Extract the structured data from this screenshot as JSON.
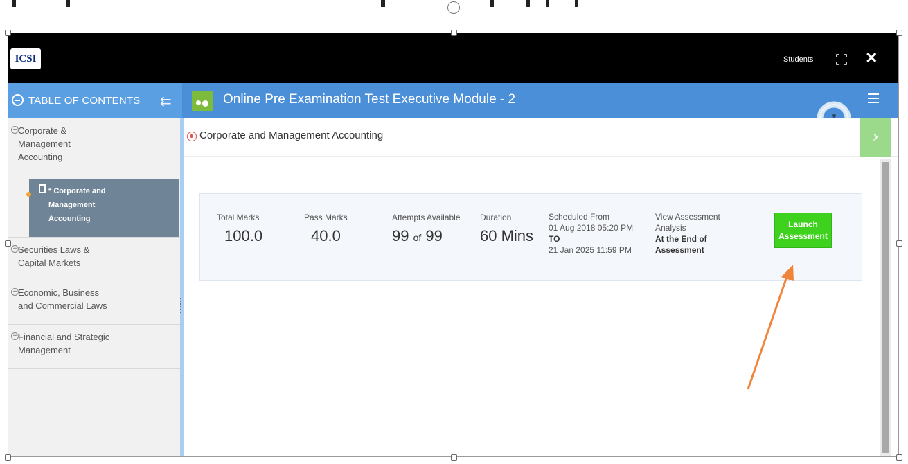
{
  "header": {
    "logo_text": "ICSI",
    "user_label": "Students"
  },
  "toc": {
    "title": "TABLE OF CONTENTS",
    "items": [
      {
        "label_lines": [
          "Corporate &",
          "Management",
          "Accounting"
        ],
        "expanded": true
      },
      {
        "label_lines": [
          "Securities Laws &",
          "Capital Markets"
        ],
        "expanded": false
      },
      {
        "label_lines": [
          "Economic, Business",
          "and Commercial Laws"
        ],
        "expanded": false
      },
      {
        "label_lines": [
          "Financial and Strategic",
          "Management"
        ],
        "expanded": false
      }
    ],
    "sub_item": {
      "label_lines": [
        "* Corporate and",
        "Management",
        "Accounting"
      ]
    }
  },
  "course": {
    "title": "Online Pre Examination Test Executive Module - 2"
  },
  "breadcrumb": {
    "title": "Corporate and Management Accounting"
  },
  "assessment": {
    "total_marks_label": "Total Marks",
    "total_marks": "100.0",
    "pass_marks_label": "Pass Marks",
    "pass_marks": "40.0",
    "attempts_label": "Attempts Available",
    "attempts_used": "99",
    "attempts_of": "of",
    "attempts_total": "99",
    "duration_label": "Duration",
    "duration": "60 Mins",
    "scheduled_label": "Scheduled From",
    "scheduled_from": "01 Aug 2018 05:20 PM",
    "scheduled_to_label": "TO",
    "scheduled_to": "21 Jan 2025 11:59 PM",
    "analysis_label_lines": [
      "View Assessment",
      "Analysis"
    ],
    "analysis_value_lines": [
      "At the End of",
      "Assessment"
    ],
    "launch_lines": [
      "Launch",
      "Assessment"
    ]
  },
  "colors": {
    "header_bg": "#000000",
    "toc_bar": "#5b9fe3",
    "main_bar": "#4c8fd9",
    "launch_btn": "#3ed11d",
    "arrow": "#f0843a"
  }
}
